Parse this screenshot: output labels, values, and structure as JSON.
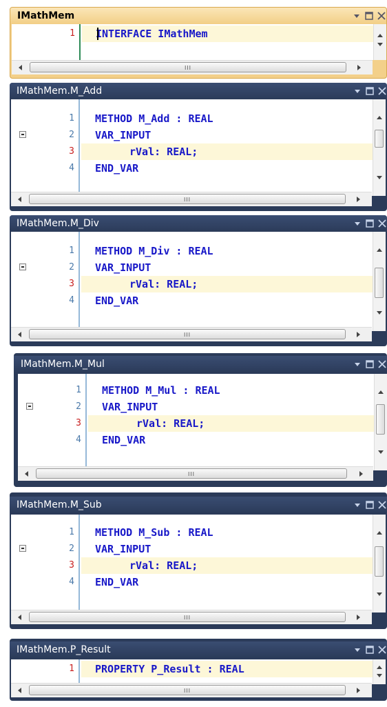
{
  "panels": [
    {
      "title": "IMathMem",
      "lines": [
        {
          "num": "1",
          "text": "INTERFACE IMathMem"
        }
      ]
    },
    {
      "title": "IMathMem.M_Add",
      "lines": [
        {
          "num": "1",
          "text": "METHOD M_Add : REAL"
        },
        {
          "num": "2",
          "text": "VAR_INPUT"
        },
        {
          "num": "3",
          "text": "rVal: REAL;"
        },
        {
          "num": "4",
          "text": "END_VAR"
        }
      ]
    },
    {
      "title": "IMathMem.M_Div",
      "lines": [
        {
          "num": "1",
          "text": "METHOD M_Div : REAL"
        },
        {
          "num": "2",
          "text": "VAR_INPUT"
        },
        {
          "num": "3",
          "text": "rVal: REAL;"
        },
        {
          "num": "4",
          "text": "END_VAR"
        }
      ]
    },
    {
      "title": "IMathMem.M_Mul",
      "lines": [
        {
          "num": "1",
          "text": "METHOD M_Mul : REAL"
        },
        {
          "num": "2",
          "text": "VAR_INPUT"
        },
        {
          "num": "3",
          "text": "rVal: REAL;"
        },
        {
          "num": "4",
          "text": "END_VAR"
        }
      ]
    },
    {
      "title": "IMathMem.M_Sub",
      "lines": [
        {
          "num": "1",
          "text": "METHOD M_Sub : REAL"
        },
        {
          "num": "2",
          "text": "VAR_INPUT"
        },
        {
          "num": "3",
          "text": "rVal: REAL;"
        },
        {
          "num": "4",
          "text": "END_VAR"
        }
      ]
    },
    {
      "title": "IMathMem.P_Result",
      "lines": [
        {
          "num": "1",
          "text": "PROPERTY P_Result : REAL"
        }
      ]
    }
  ],
  "icons": {
    "dropdown": "dropdown-arrow-icon",
    "maximize": "maximize-icon",
    "close": "close-icon",
    "collapse": "collapse-minus-icon"
  },
  "colors": {
    "active_title": "#f3d08a",
    "inactive_title": "#2b3b59",
    "keyword": "#1818c8",
    "line_number": "#4a79a9",
    "current_line_number": "#c81e1e",
    "current_line_bg": "#fdf7d8"
  }
}
